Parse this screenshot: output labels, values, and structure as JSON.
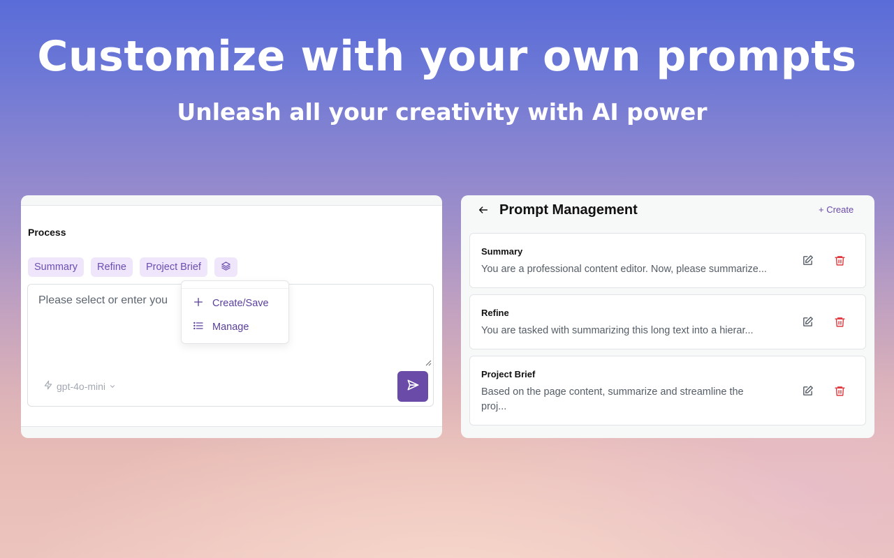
{
  "hero": {
    "title": "Customize with your own prompts",
    "subtitle": "Unleash all your creativity with AI power"
  },
  "process_panel": {
    "section_label": "Process",
    "chips": [
      "Summary",
      "Refine",
      "Project Brief"
    ],
    "chip_menu_icon": "layers-icon",
    "editor_text": "Please select or enter you",
    "model": "gpt-4o-mini",
    "model_icon": "lightning-icon",
    "send_icon": "send-icon",
    "menu": {
      "items": [
        {
          "label": "Create/Save",
          "icon": "plus-icon"
        },
        {
          "label": "Manage",
          "icon": "list-icon"
        }
      ]
    }
  },
  "prompt_management": {
    "title": "Prompt Management",
    "create_label": "+ Create",
    "items": [
      {
        "name": "Summary",
        "description": "You are a professional content editor. Now, please summarize..."
      },
      {
        "name": "Refine",
        "description": "You are tasked with summarizing this long text into a hierar..."
      },
      {
        "name": "Project Brief",
        "description": "Based on the page content, summarize and streamline the proj..."
      }
    ]
  },
  "colors": {
    "accent": "#6a4ba8",
    "chip_bg": "#efe6fb",
    "delete_red": "#e0393e"
  }
}
